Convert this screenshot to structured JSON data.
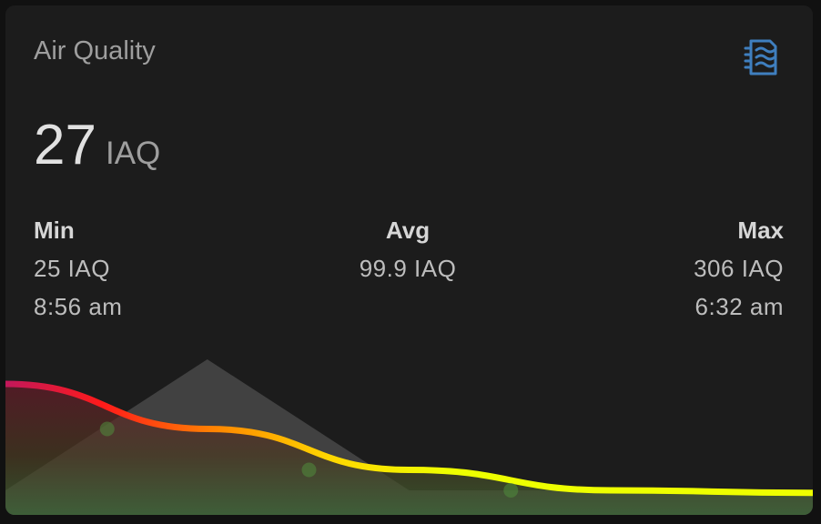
{
  "card": {
    "title": "Air Quality",
    "icon": "air-filter-icon",
    "icon_color": "#3f7fbf"
  },
  "state": {
    "value": "27",
    "unit": "IAQ"
  },
  "stats": {
    "min": {
      "label": "Min",
      "value": "25 IAQ",
      "time": "8:56 am"
    },
    "avg": {
      "label": "Avg",
      "value": "99.9 IAQ"
    },
    "max": {
      "label": "Max",
      "value": "306 IAQ",
      "time": "6:32 am"
    }
  },
  "colors": {
    "background": "#1c1c1c",
    "line_gradient": [
      "#c2185b",
      "#ff1a1a",
      "#ff8c00",
      "#ffd600",
      "#eeff00"
    ],
    "fill_bottom": "#4a7a3a",
    "secondary_fill": "#464646"
  },
  "chart_data": {
    "type": "line",
    "series": [
      {
        "values": [
          160,
          105,
          55,
          30,
          27
        ]
      },
      {
        "values": [
          30,
          190,
          30,
          30,
          30
        ]
      }
    ]
  }
}
